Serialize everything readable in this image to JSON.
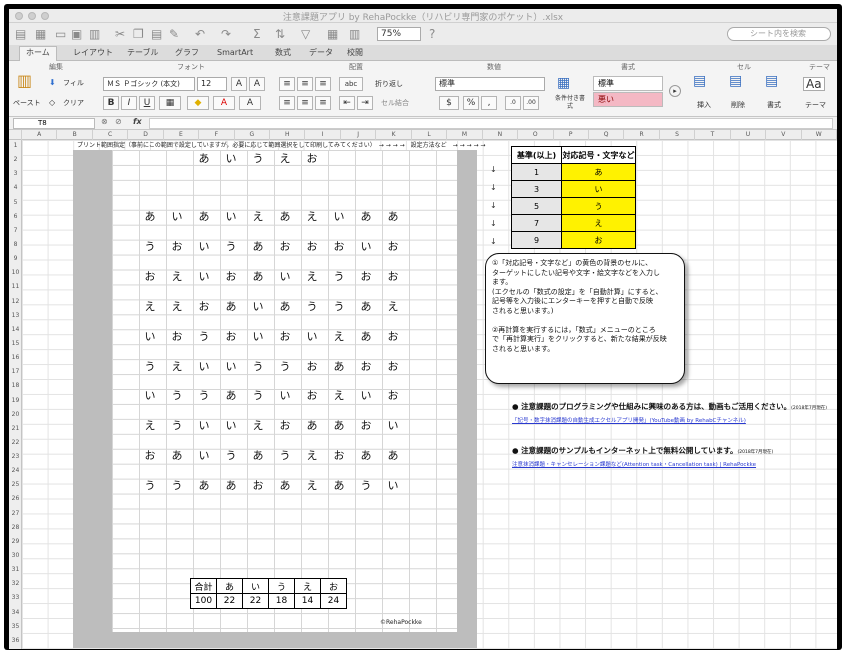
{
  "app": {
    "title": "注意課題アプリ by RehaPockke（リハビリ専門家のポケット）.xlsx",
    "zoom": "75%",
    "search_placeholder": "シート内を検索"
  },
  "tabs": [
    "ホーム",
    "レイアウト",
    "テーブル",
    "グラフ",
    "SmartArt",
    "数式",
    "データ",
    "校閲"
  ],
  "ribbon": {
    "groups": [
      "編集",
      "フォント",
      "配置",
      "数値",
      "書式",
      "セル",
      "テーマ"
    ],
    "paste": "ペースト",
    "fill": "フィル",
    "clear": "クリア",
    "font_name": "ＭＳ Ｐゴシック (本文)",
    "font_size": "12",
    "bold": "B",
    "italic": "I",
    "underline": "U",
    "wrap": "折り返し",
    "merge": "セル結合",
    "number_format": "標準",
    "cond_format": "条件付き書式",
    "style_normal": "標準",
    "style_bad": "悪い",
    "insert": "挿入",
    "delete": "削除",
    "format": "書式",
    "theme": "テーマ"
  },
  "formula_bar": {
    "cell": "T8",
    "fx": "fx",
    "value": ""
  },
  "columns": [
    "A",
    "B",
    "C",
    "D",
    "E",
    "F",
    "G",
    "H",
    "I",
    "J",
    "K",
    "L",
    "M",
    "N",
    "O",
    "P",
    "Q",
    "R",
    "S",
    "T",
    "U",
    "V",
    "W"
  ],
  "rows": [
    "1",
    "2",
    "3",
    "4",
    "5",
    "6",
    "7",
    "8",
    "9",
    "10",
    "11",
    "12",
    "13",
    "14",
    "15",
    "16",
    "17",
    "18",
    "19",
    "20",
    "21",
    "22",
    "23",
    "24",
    "25",
    "26",
    "27",
    "28",
    "29",
    "30",
    "31",
    "32",
    "33",
    "34",
    "35",
    "36"
  ],
  "sheet": {
    "header_note": "プリント範囲指定（事前にこの範囲で設定していますが，必要に応じて範囲選択をして印刷してみてください）　→ → → →　設定方法など　→ → → → →",
    "target_row": [
      "あ",
      "い",
      "う",
      "え",
      "お"
    ],
    "grid": [
      [
        "あ",
        "い",
        "あ",
        "い",
        "え",
        "あ",
        "え",
        "い",
        "あ",
        "あ"
      ],
      [
        "う",
        "お",
        "い",
        "う",
        "あ",
        "お",
        "お",
        "お",
        "い",
        "お"
      ],
      [
        "お",
        "え",
        "い",
        "お",
        "あ",
        "い",
        "え",
        "う",
        "お",
        "お"
      ],
      [
        "え",
        "え",
        "お",
        "あ",
        "い",
        "あ",
        "う",
        "う",
        "あ",
        "え"
      ],
      [
        "い",
        "お",
        "う",
        "お",
        "い",
        "お",
        "い",
        "え",
        "あ",
        "お"
      ],
      [
        "う",
        "え",
        "い",
        "い",
        "う",
        "う",
        "お",
        "あ",
        "お",
        "お"
      ],
      [
        "い",
        "う",
        "う",
        "あ",
        "う",
        "い",
        "お",
        "え",
        "い",
        "お"
      ],
      [
        "え",
        "う",
        "い",
        "い",
        "え",
        "お",
        "あ",
        "あ",
        "お",
        "い"
      ],
      [
        "お",
        "あ",
        "い",
        "う",
        "あ",
        "う",
        "え",
        "お",
        "あ",
        "あ"
      ],
      [
        "う",
        "う",
        "あ",
        "あ",
        "お",
        "あ",
        "え",
        "あ",
        "う",
        "い"
      ]
    ],
    "totals": {
      "header": [
        "合計",
        "あ",
        "い",
        "う",
        "え",
        "お"
      ],
      "values": [
        "100",
        "22",
        "22",
        "18",
        "14",
        "24"
      ]
    },
    "copyright": "©RehaPockke"
  },
  "reference": {
    "headers": [
      "基準(以上)",
      "対応記号・文字など"
    ],
    "rows": [
      [
        "1",
        "あ"
      ],
      [
        "3",
        "い"
      ],
      [
        "5",
        "う"
      ],
      [
        "7",
        "え"
      ],
      [
        "9",
        "お"
      ]
    ],
    "arrow": "↓"
  },
  "bubble": [
    "①「対応記号・文字など」の黄色の背景のセルに、",
    "ターゲットにしたい記号や文字・絵文字などを入力し",
    "ます。",
    "(エクセルの「数式の設定」を「自動計算」にすると、",
    "記号等を入力後にエンターキーを押すと自動で反映",
    "されると思います。)",
    "",
    "②再計算を実行するには，「数式」メニューのところ",
    "で「再計算実行」をクリックすると、新たな結果が反映",
    "されると思います。"
  ],
  "info": [
    {
      "text": "● 注意課題のプログラミングや仕組みに興味のある方は、動画もご活用ください。",
      "date": "(2018年7月現在)",
      "link": "「記号・数字抹消課題の自動生成エクセルアプリ開発」(YouTube動画 by RehabCチャンネル)"
    },
    {
      "text": "● 注意課題のサンプルもインターネット上で無料公開しています。",
      "date": "(2018年7月現在)",
      "link": "注意抹消課題・キャンセレーション課題など(Attention task・Cancellation task) | RehaPockke"
    }
  ],
  "colors": {
    "yellow": "#fff200",
    "bad_style": "#f4b8c4",
    "link": "#2a3ad0"
  }
}
